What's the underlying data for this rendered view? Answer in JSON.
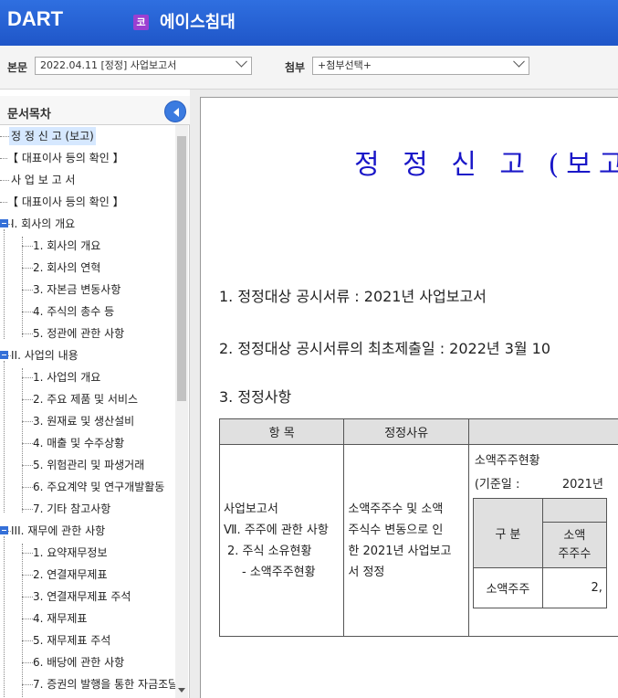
{
  "header": {
    "logo": "DART",
    "corp_badge": "코",
    "corp_name": "에이스침대"
  },
  "selectors": {
    "main_label": "본문",
    "main_value": "2022.04.11 [정정] 사업보고서",
    "attach_label": "첨부",
    "attach_value": "+첨부선택+"
  },
  "toc": {
    "title": "문서목차",
    "items": [
      {
        "label": "정 정 신 고 (보고)"
      },
      {
        "label": "【 대표이사 등의 확인 】"
      },
      {
        "label": "사 업 보 고 서"
      },
      {
        "label": "【 대표이사 등의 확인 】"
      },
      {
        "label": "I. 회사의 개요"
      },
      {
        "label": "1. 회사의 개요"
      },
      {
        "label": "2. 회사의 연혁"
      },
      {
        "label": "3. 자본금 변동사항"
      },
      {
        "label": "4. 주식의 총수 등"
      },
      {
        "label": "5. 정관에 관한 사항"
      },
      {
        "label": "II. 사업의 내용"
      },
      {
        "label": "1. 사업의 개요"
      },
      {
        "label": "2. 주요 제품 및 서비스"
      },
      {
        "label": "3. 원재료 및 생산설비"
      },
      {
        "label": "4. 매출 및 수주상황"
      },
      {
        "label": "5. 위험관리 및 파생거래"
      },
      {
        "label": "6. 주요계약 및 연구개발활동"
      },
      {
        "label": "7. 기타 참고사항"
      },
      {
        "label": "III. 재무에 관한 사항"
      },
      {
        "label": "1. 요약재무정보"
      },
      {
        "label": "2. 연결재무제표"
      },
      {
        "label": "3. 연결재무제표 주석"
      },
      {
        "label": "4. 재무제표"
      },
      {
        "label": "5. 재무제표 주석"
      },
      {
        "label": "6. 배당에 관한 사항"
      },
      {
        "label": "7. 증권의 발행을 통한 자금조달"
      }
    ]
  },
  "document": {
    "title": "정 정 신 고 (보고",
    "line1": "1. 정정대상 공시서류 : 2021년 사업보고서",
    "line2": "2. 정정대상 공시서류의 최초제출일 : 2022년 3월 10",
    "line3": "3. 정정사항",
    "table": {
      "col1_header": "항 목",
      "col2_header": "정정사유",
      "col3_header": "",
      "item_lines": [
        "사업보고서",
        "Ⅶ. 주주에 관한 사항",
        " 2. 주식 소유현황",
        "   - 소액주주현황"
      ],
      "reason_lines": [
        "소액주주수 및 소액",
        "주식수 변동으로 인",
        "한 2021년 사업보고",
        "서 정정"
      ],
      "content_title": "소액주주현황",
      "content_date_label": "(기준일 :",
      "content_date_value": "2021년",
      "inner_header_1": "구 분",
      "inner_header_2a": "소액",
      "inner_header_2b": "주주수",
      "inner_row_label": "소액주주",
      "inner_row_value": "2,"
    }
  }
}
